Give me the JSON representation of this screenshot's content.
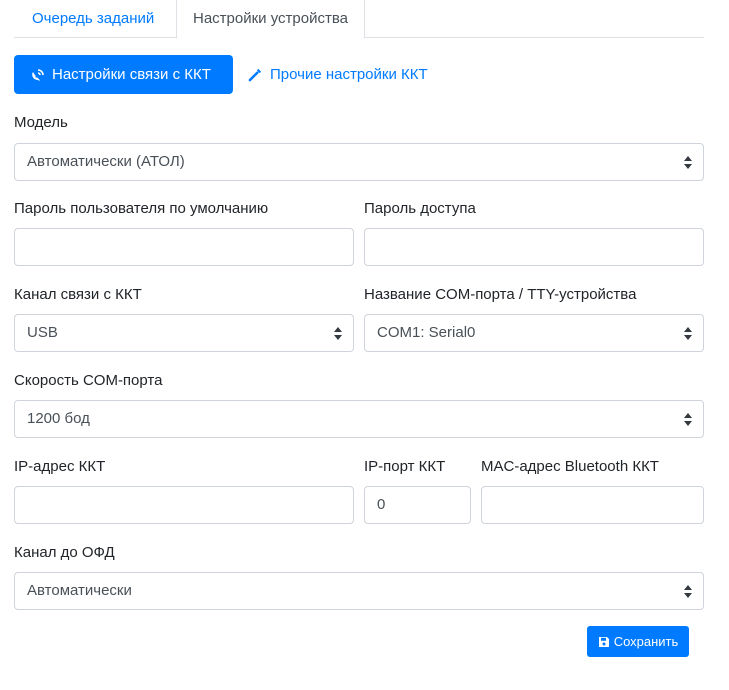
{
  "tabs": [
    {
      "label": "Очередь заданий",
      "active": false
    },
    {
      "label": "Настройки устройства",
      "active": true
    }
  ],
  "pills": {
    "connection_label": "Настройки связи с ККТ",
    "connection_icon": "satellite-dish-icon",
    "other_label": "Прочие настройки ККТ",
    "other_icon": "magic-wand-icon"
  },
  "form": {
    "model": {
      "label": "Модель",
      "value": "Автоматически (АТОЛ)"
    },
    "default_password": {
      "label": "Пароль пользователя по умолчанию",
      "value": ""
    },
    "access_password": {
      "label": "Пароль доступа",
      "value": ""
    },
    "channel": {
      "label": "Канал связи с ККТ",
      "value": "USB"
    },
    "com_port_name": {
      "label": "Название COM-порта / TTY-устройства",
      "value": "COM1: Serial0"
    },
    "com_speed": {
      "label": "Скорость COM-порта",
      "value": "1200 бод"
    },
    "ip_address": {
      "label": "IP-адрес ККТ",
      "value": ""
    },
    "ip_port": {
      "label": "IP-порт ККТ",
      "value": "0"
    },
    "mac_address": {
      "label": "MAC-адрес Bluetooth ККТ",
      "value": ""
    },
    "ofd_channel": {
      "label": "Канал до ОФД",
      "value": "Автоматически"
    }
  },
  "save": {
    "label": "Сохранить",
    "icon": "floppy-disk-icon"
  },
  "colors": {
    "primary": "#007bff",
    "border": "#ced4da",
    "text": "#212529"
  }
}
